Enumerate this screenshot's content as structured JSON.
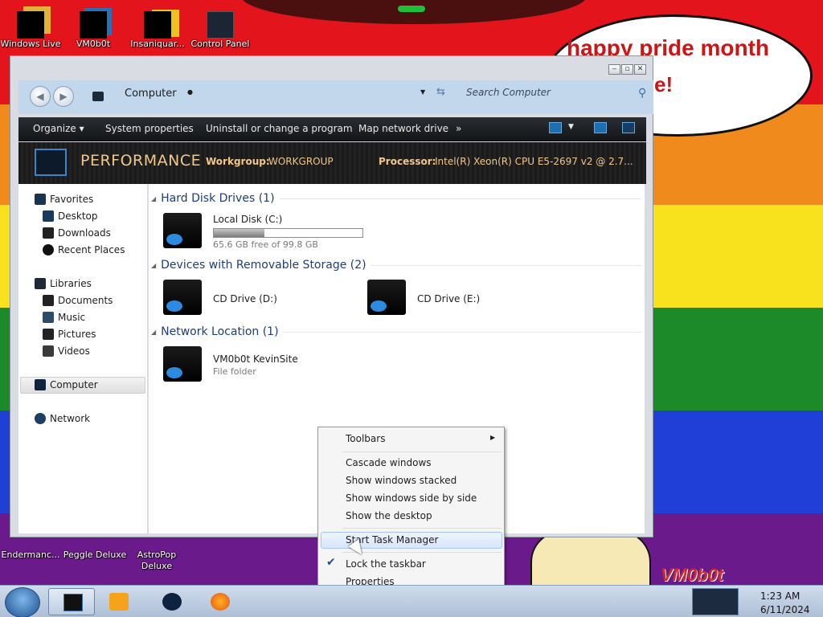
{
  "desktop": {
    "bubble_line1": "happy pride month",
    "bubble_line2": "e!",
    "watermark": "VM0b0t",
    "icons": [
      {
        "label": "Windows Live"
      },
      {
        "label": "VM0b0t"
      },
      {
        "label": "Insaniquar..."
      },
      {
        "label": "Control Panel"
      },
      {
        "label": "Endermanc..."
      },
      {
        "label": "Peggle Deluxe"
      },
      {
        "label": "AstroPop Deluxe"
      }
    ]
  },
  "window": {
    "address": "Computer",
    "search_placeholder": "Search Computer",
    "toolbar": {
      "organize": "Organize",
      "system_properties": "System properties",
      "uninstall": "Uninstall or change a program",
      "map_drive": "Map network drive",
      "more": "»"
    },
    "details": {
      "name": "PERFORMANCE",
      "workgroup_label": "Workgroup:",
      "workgroup_value": "WORKGROUP",
      "processor_label": "Processor:",
      "processor_value": "Intel(R) Xeon(R) CPU E5-2697 v2 @ 2.7..."
    },
    "nav": {
      "favorites": "Favorites",
      "desktop": "Desktop",
      "downloads": "Downloads",
      "recent_places": "Recent Places",
      "libraries": "Libraries",
      "documents": "Documents",
      "music": "Music",
      "pictures": "Pictures",
      "videos": "Videos",
      "computer": "Computer",
      "network": "Network"
    },
    "groups": {
      "hdd": "Hard Disk Drives (1)",
      "removable": "Devices with Removable Storage (2)",
      "network": "Network Location (1)"
    },
    "items": {
      "local_disk": "Local Disk (C:)",
      "local_disk_free": "65.6 GB free of 99.8 GB",
      "local_disk_used_fraction": 0.343,
      "cd_d": "CD Drive (D:)",
      "cd_e": "CD Drive (E:)",
      "netloc_name": "VM0b0t KevinSite",
      "netloc_type": "File folder"
    }
  },
  "context_menu": {
    "toolbars": "Toolbars",
    "cascade": "Cascade windows",
    "stacked": "Show windows stacked",
    "side_by_side": "Show windows side by side",
    "show_desktop": "Show the desktop",
    "task_manager": "Start Task Manager",
    "lock_taskbar": "Lock the taskbar",
    "properties": "Properties"
  },
  "taskbar": {
    "time": "1:23 AM",
    "date": "6/11/2024"
  }
}
